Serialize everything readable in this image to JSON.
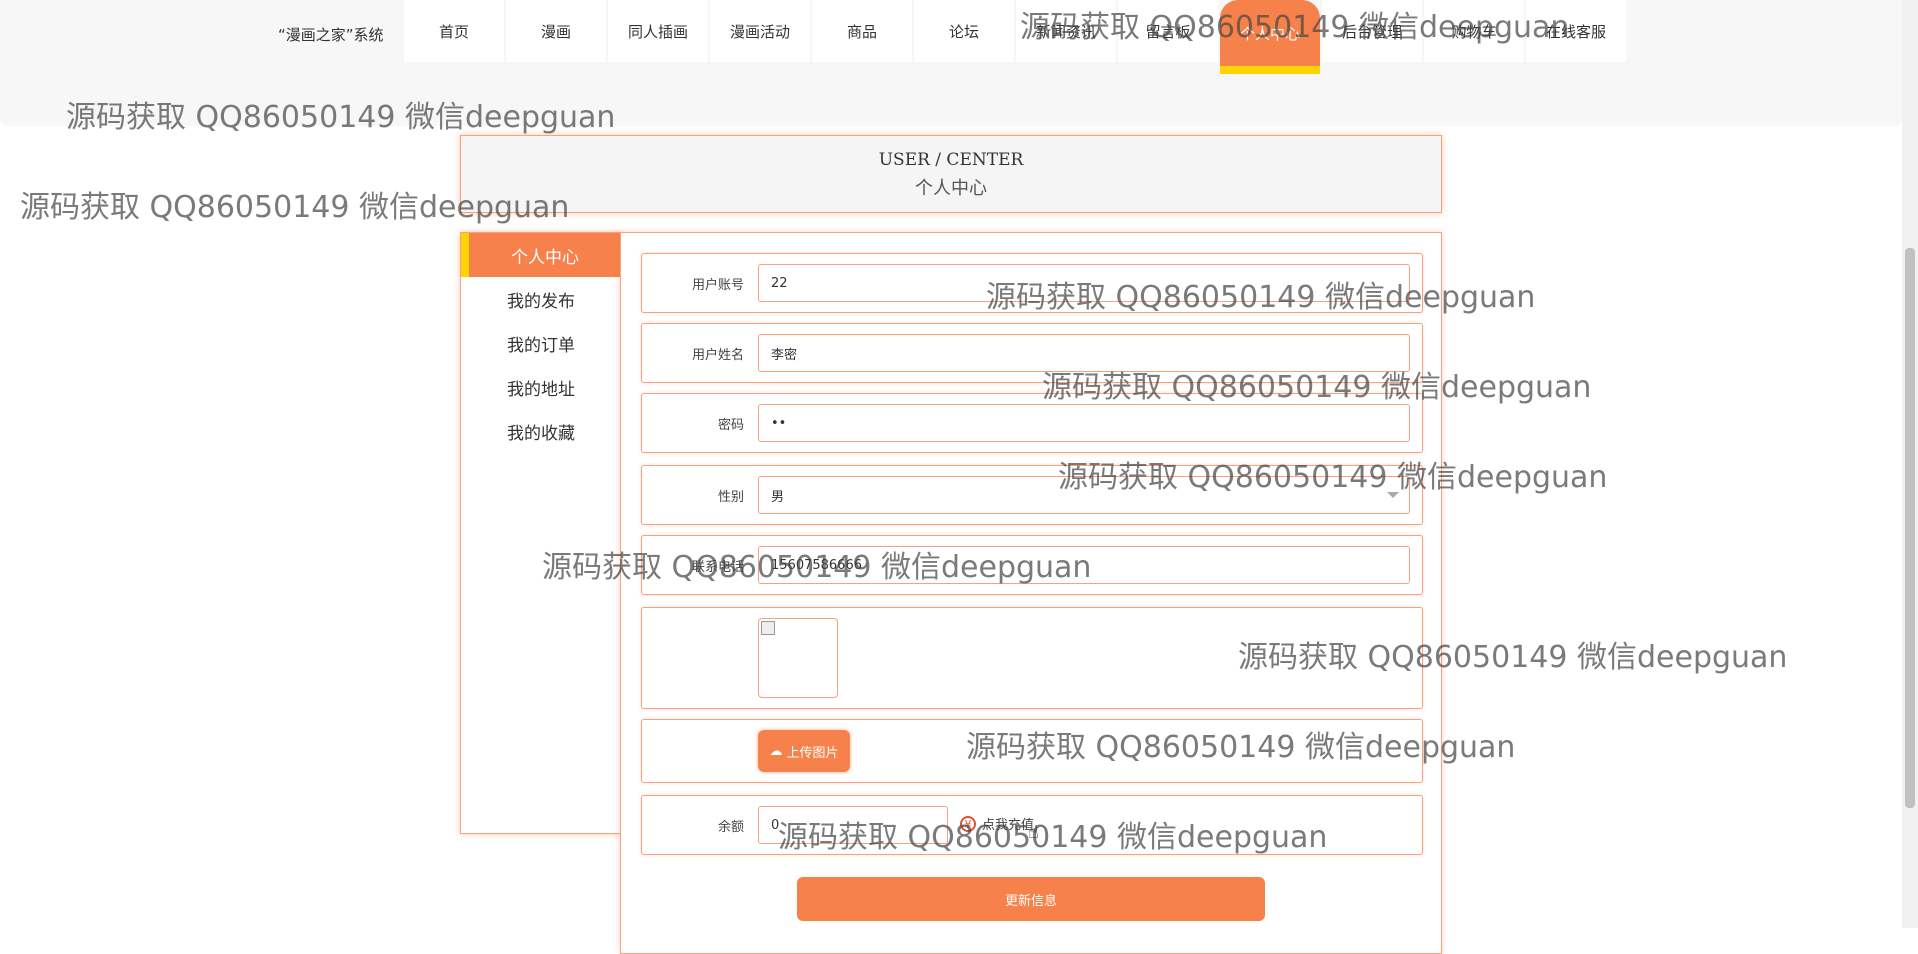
{
  "header": {
    "brand": "“漫画之家”系统",
    "nav": [
      "首页",
      "漫画",
      "同人插画",
      "漫画活动",
      "商品",
      "论坛",
      "新闻资讯",
      "留言板",
      "个人中心",
      "后台管理",
      "购物车",
      "在线客服"
    ],
    "active_nav": "个人中心"
  },
  "title": {
    "en": "USER / CENTER",
    "cn": "个人中心"
  },
  "sidebar": {
    "items": [
      "个人中心",
      "我的发布",
      "我的订单",
      "我的地址",
      "我的收藏"
    ]
  },
  "form": {
    "account_label": "用户账号",
    "account_value": "22",
    "name_label": "用户姓名",
    "name_value": "李密",
    "password_label": "密码",
    "password_value": "••",
    "gender_label": "性别",
    "gender_value": "男",
    "phone_label": "联系电话",
    "phone_value": "15607586666",
    "upload_label": "上传图片",
    "balance_label": "余额",
    "balance_value": "0",
    "recharge_label": "点我充值",
    "submit_label": "更新信息"
  },
  "watermark": "源码获取 QQ86050149 微信deepguan",
  "colors": {
    "accent": "#f7814a",
    "highlight": "#fdd400",
    "border": "#f7a27e"
  },
  "icons": {
    "upload": "cloud-upload-icon",
    "recharge": "recharge-icon",
    "cursor": "pointer-cursor-icon"
  }
}
